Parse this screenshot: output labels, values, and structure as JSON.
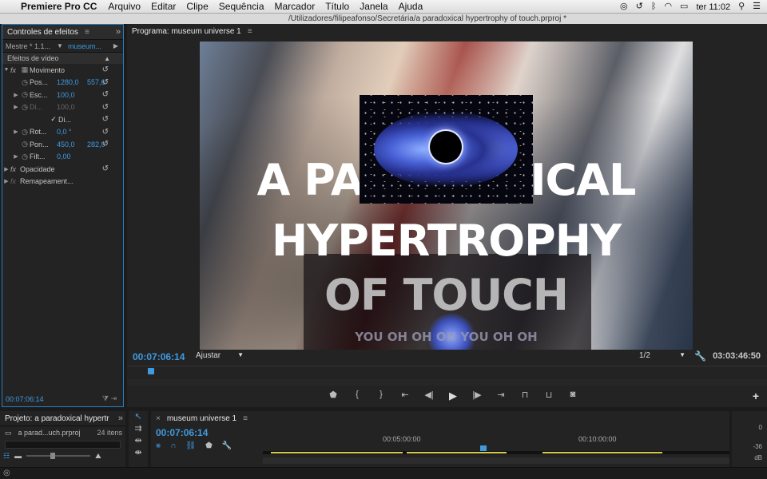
{
  "menubar": {
    "app_name": "Premiere Pro CC",
    "items": [
      "Arquivo",
      "Editar",
      "Clipe",
      "Sequência",
      "Marcador",
      "Título",
      "Janela",
      "Ajuda"
    ],
    "clock": "ter 11:02"
  },
  "titlebar": {
    "path": "/Utilizadores/filipeafonso/Secretária/a paradoxical hypertrophy of touch.prproj *"
  },
  "effects": {
    "tab_label": "Controles de efeitos",
    "master_label": "Mestre * 1.1...",
    "clip_label": "museum...",
    "section_label": "Efeitos de vídeo",
    "motion_label": "Movimento",
    "rows": [
      {
        "label": "Pos...",
        "v1": "1280,0",
        "v2": "557,6"
      },
      {
        "label": "Esc...",
        "v1": "100,0",
        "v2": ""
      },
      {
        "label": "Di...",
        "v1": "100,0",
        "v2": ""
      },
      {
        "label": "Di...",
        "v1": "",
        "v2": ""
      },
      {
        "label": "Rot...",
        "v1": "0,0 °",
        "v2": ""
      },
      {
        "label": "Pon...",
        "v1": "450,0",
        "v2": "282,0"
      },
      {
        "label": "Filt...",
        "v1": "0,00",
        "v2": ""
      }
    ],
    "opacity_label": "Opacidade",
    "remap_label": "Remapeament...",
    "timecode": "00:07:06:14"
  },
  "program": {
    "tab_label": "Programa: museum universe 1",
    "title_lines": [
      "A PARADOXICAL",
      "HYPERTROPHY",
      "OF TOUCH",
      "YOU OH OH OH YOU OH OH"
    ],
    "timecode": "00:07:06:14",
    "fit": "Ajustar",
    "resolution": "1/2",
    "duration": "03:03:46:50"
  },
  "project": {
    "tab_label": "Projeto: a paradoxical hypertr",
    "file_name": "a parad...uch.prproj",
    "item_count": "24 itens"
  },
  "timeline": {
    "tab_label": "museum universe 1",
    "timecode": "00:07:06:14",
    "marks": [
      "00:05:00:00",
      "00:10:00:00"
    ]
  },
  "audio": {
    "levels": [
      "0",
      "-36",
      "dB"
    ]
  },
  "colors": {
    "accent": "#3f9ae0",
    "background": "#232323",
    "work_area": "#d8c84a"
  }
}
